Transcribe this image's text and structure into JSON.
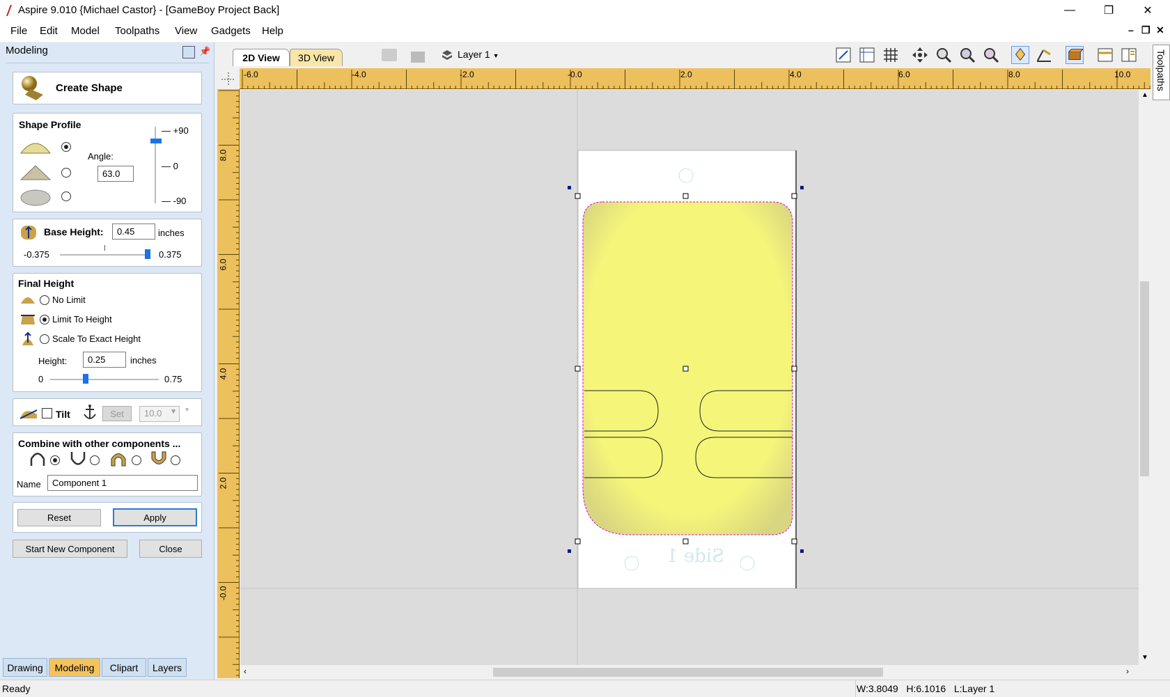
{
  "title_bar": {
    "title": "Aspire 9.010 {Michael Castor} - [GameBoy Project Back]",
    "minimize": "—",
    "restore": "❐",
    "close": "✕"
  },
  "menu": {
    "items": [
      "File",
      "Edit",
      "Model",
      "Toolpaths",
      "View",
      "Gadgets",
      "Help"
    ],
    "mdi_minimize": "–",
    "mdi_restore": "❐",
    "mdi_close": "✕"
  },
  "panel": {
    "header": "Modeling",
    "create_shape": "Create Shape",
    "shape_profile": {
      "title": "Shape Profile",
      "angle_label": "Angle:",
      "angle_value": "63.0",
      "slider_max": "+90",
      "slider_mid": "0",
      "slider_min": "-90",
      "selected_profile": 0
    },
    "base_height": {
      "label": "Base Height:",
      "value": "0.45",
      "unit": "inches",
      "min": "-0.375",
      "max": "0.375"
    },
    "final_height": {
      "title": "Final Height",
      "options": [
        "No Limit",
        "Limit To Height",
        "Scale To Exact Height"
      ],
      "selected": 1,
      "height_label": "Height:",
      "height_value": "0.25",
      "unit": "inches",
      "min": "0",
      "max": "0.75"
    },
    "tilt": {
      "label": "Tilt",
      "set": "Set",
      "value": "10.0",
      "degree": "°"
    },
    "combine": {
      "title": "Combine with other components ...",
      "selected": 0,
      "name_label": "Name",
      "name_value": "Component 1"
    },
    "buttons": {
      "reset": "Reset",
      "apply": "Apply",
      "start_new": "Start New Component",
      "close": "Close"
    },
    "tabs": [
      "Drawing",
      "Modeling",
      "Clipart",
      "Layers"
    ],
    "active_tab": "Modeling"
  },
  "view": {
    "tab_2d": "2D View",
    "tab_3d": "3D View",
    "layer": "Layer 1",
    "right_tab": "Toolpaths",
    "top_ruler": [
      "-6.0",
      "-4.0",
      "-2.0",
      "-0.0",
      "2.0",
      "4.0",
      "6.0",
      "8.0",
      "10.0"
    ],
    "left_ruler": [
      "8.0",
      "6.0",
      "4.0",
      "2.0",
      "-0.0"
    ],
    "canvas_text": "Side 1",
    "colors": {
      "ruler": "#edc05e",
      "shape_fill": "#f5f57a",
      "selection": "#d400d4"
    }
  },
  "status": {
    "left": "Ready",
    "right": "W:3.8049   H:6.1016   L:Layer 1"
  }
}
